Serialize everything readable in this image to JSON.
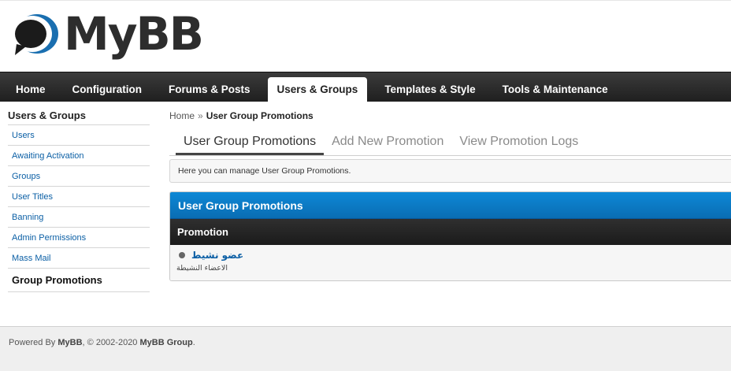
{
  "brand": {
    "name": "MyBB"
  },
  "nav": {
    "tabs": [
      {
        "label": "Home",
        "active": false
      },
      {
        "label": "Configuration",
        "active": false
      },
      {
        "label": "Forums & Posts",
        "active": false
      },
      {
        "label": "Users & Groups",
        "active": true
      },
      {
        "label": "Templates & Style",
        "active": false
      },
      {
        "label": "Tools & Maintenance",
        "active": false
      }
    ]
  },
  "sidebar": {
    "title": "Users & Groups",
    "items": [
      {
        "label": "Users"
      },
      {
        "label": "Awaiting Activation"
      },
      {
        "label": "Groups"
      },
      {
        "label": "User Titles"
      },
      {
        "label": "Banning"
      },
      {
        "label": "Admin Permissions"
      },
      {
        "label": "Mass Mail"
      },
      {
        "label": "Group Promotions",
        "active": true
      }
    ]
  },
  "breadcrumb": {
    "home": "Home",
    "separator": "»",
    "current": "User Group Promotions"
  },
  "subtabs": [
    {
      "label": "User Group Promotions",
      "active": true
    },
    {
      "label": "Add New Promotion",
      "active": false
    },
    {
      "label": "View Promotion Logs",
      "active": false
    }
  ],
  "notice": "Here you can manage User Group Promotions.",
  "panel": {
    "title": "User Group Promotions",
    "column": "Promotion",
    "rows": [
      {
        "name": "عضو نشيط",
        "description": "الاعضاء النشيطة"
      }
    ]
  },
  "footer": {
    "prefix": "Powered By",
    "brand": "MyBB",
    "copyright": ", © 2002-2020",
    "group": "MyBB Group",
    "suffix": "."
  },
  "colors": {
    "accent": "#0a7bc5",
    "link": "#0b5fa5",
    "navbar": "#2b2b2b"
  }
}
